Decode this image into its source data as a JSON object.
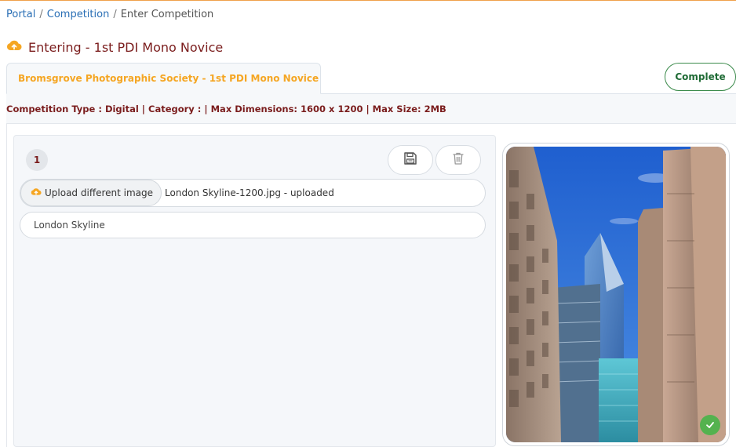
{
  "breadcrumb": {
    "items": [
      "Portal",
      "Competition"
    ],
    "current": "Enter Competition",
    "separator": "/"
  },
  "page": {
    "title": "Entering - 1st PDI Mono Novice",
    "icon": "cloud-upload-icon"
  },
  "tabs": {
    "active": "Bromsgrove Photographic Society - 1st PDI Mono Novice"
  },
  "actions": {
    "complete_label": "Complete"
  },
  "competition_info": "Competition Type : Digital | Category : | Max Dimensions: 1600 x 1200 | Max Size: 2MB",
  "entry": {
    "number": "1",
    "save_icon": "floppy-disk-icon",
    "delete_icon": "trash-icon",
    "upload_button_label": "Upload different image",
    "upload_status": "London Skyline-1200.jpg - uploaded",
    "title_value": "London Skyline",
    "status_icon": "check-circle-icon"
  },
  "colors": {
    "accent_orange": "#f5a623",
    "title_maroon": "#7a1c1c",
    "link_blue": "#2a6fb5",
    "complete_green": "#1f6b35",
    "check_green": "#54b24f"
  }
}
